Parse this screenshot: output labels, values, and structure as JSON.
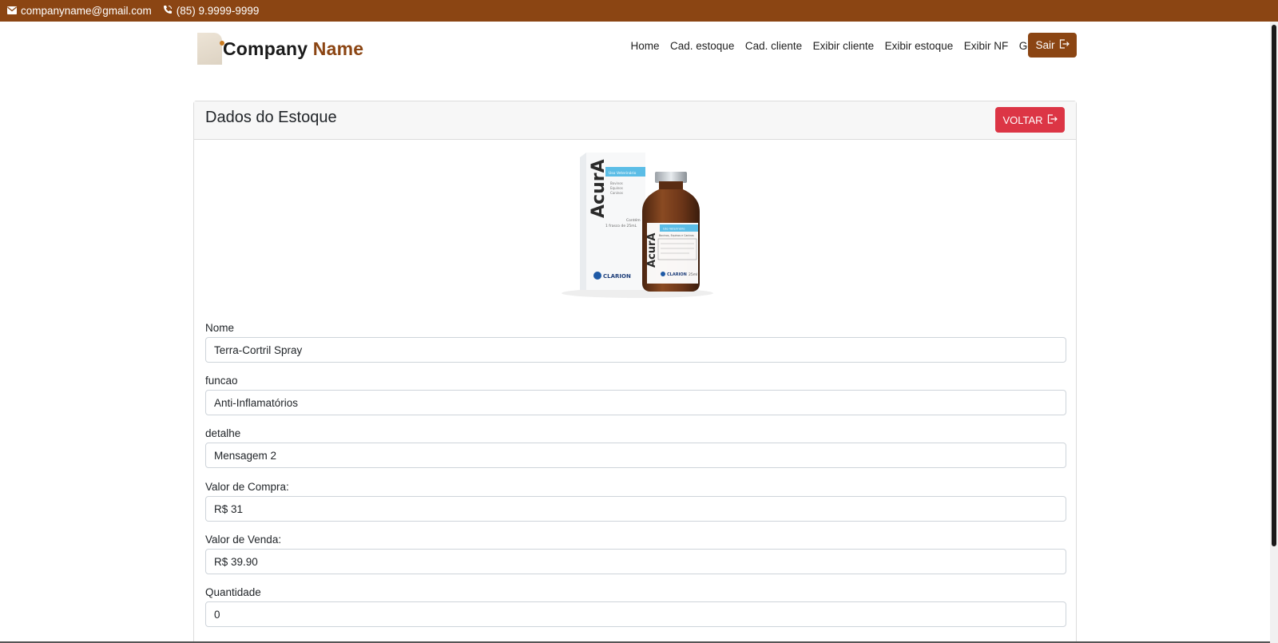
{
  "topbar": {
    "email": "companyname@gmail.com",
    "phone": "(85) 9.9999-9999",
    "bg_color": "#8b4513"
  },
  "brand": {
    "name_part1": "Company",
    "name_part2": "Name",
    "accent_color": "#8b4513"
  },
  "nav": {
    "items": [
      "Home",
      "Cad. estoque",
      "Cad. cliente",
      "Exibir cliente",
      "Exibir estoque",
      "Exibir NF",
      "Gerar NF"
    ],
    "logout_label": "Sair"
  },
  "card": {
    "title": "Dados do Estoque",
    "back_label": "VOLTAR",
    "back_color": "#dc3545"
  },
  "product_image": {
    "box_brand": "AcurA",
    "box_tag": "Uso Veterinário",
    "box_species": [
      "Bovinos",
      "Equinos",
      "Caninos"
    ],
    "box_content": [
      "Contém",
      "1 frasco de 25mL"
    ],
    "maker": "CLARION",
    "bottle_tag": "Uso Veterinário",
    "bottle_species": "Bovinos, Equinos e Caninos",
    "bottle_volume": "25ml"
  },
  "form": {
    "fields": [
      {
        "label": "Nome",
        "value": "Terra-Cortril Spray"
      },
      {
        "label": "funcao",
        "value": "Anti-Inflamatórios"
      },
      {
        "label": "detalhe",
        "value": "Mensagem 2"
      },
      {
        "label": "Valor de Compra:",
        "value": "R$ 31"
      },
      {
        "label": "Valor de Venda:",
        "value": "R$ 39.90"
      },
      {
        "label": "Quantidade",
        "value": "0"
      }
    ]
  }
}
